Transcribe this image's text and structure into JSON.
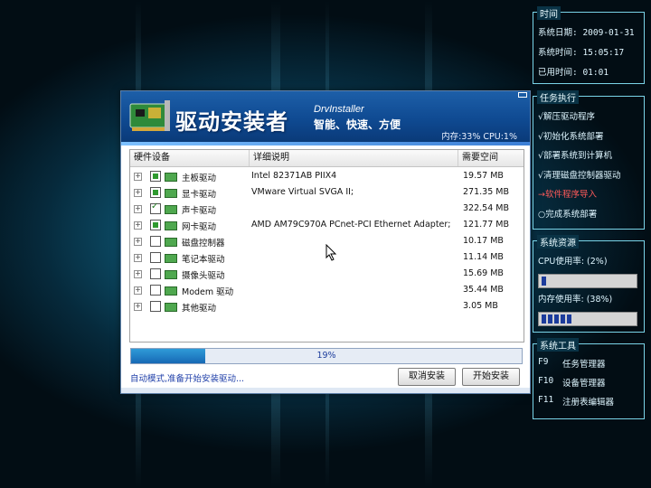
{
  "window": {
    "title": "驱动安装者",
    "brand": "DrvInstaller",
    "slogan": "智能、快速、方便",
    "stats": "内存:33%  CPU:1%"
  },
  "columns": [
    "硬件设备",
    "详细说明",
    "需要空间"
  ],
  "devices": [
    {
      "name": "主板驱动",
      "detail": "Intel 82371AB PIIX4",
      "size": "19.57 MB",
      "checked": "filled"
    },
    {
      "name": "显卡驱动",
      "detail": "VMware Virtual SVGA II;",
      "size": "271.35 MB",
      "checked": "filled"
    },
    {
      "name": "声卡驱动",
      "detail": "",
      "size": "322.54 MB",
      "checked": "tick"
    },
    {
      "name": "网卡驱动",
      "detail": "AMD AM79C970A PCnet-PCI Ethernet Adapter;",
      "size": "121.77 MB",
      "checked": "filled"
    },
    {
      "name": "磁盘控制器",
      "detail": "",
      "size": "10.17 MB",
      "checked": "none"
    },
    {
      "name": "笔记本驱动",
      "detail": "",
      "size": "11.14 MB",
      "checked": "none"
    },
    {
      "name": "摄像头驱动",
      "detail": "",
      "size": "15.69 MB",
      "checked": "none"
    },
    {
      "name": "Modem 驱动",
      "detail": "",
      "size": "35.44 MB",
      "checked": "none"
    },
    {
      "name": "其他驱动",
      "detail": "",
      "size": "3.05 MB",
      "checked": "none"
    }
  ],
  "progress": {
    "percent": 19,
    "label": "19%"
  },
  "status_text": "自动模式,准备开始安装驱动...",
  "buttons": {
    "cancel": "取消安装",
    "start": "开始安装"
  },
  "side": {
    "time": {
      "title": "时间",
      "date": "系统日期: 2009-01-31",
      "clock": "系统时间: 15:05:17",
      "elapsed": "已用时间: 01:01"
    },
    "tasks": {
      "title": "任务执行",
      "items": [
        {
          "label": "√解压驱动程序",
          "state": "done"
        },
        {
          "label": "√初始化系统部署",
          "state": "done"
        },
        {
          "label": "√部署系统到计算机",
          "state": "done"
        },
        {
          "label": "√清理磁盘控制器驱动",
          "state": "done"
        },
        {
          "label": "→软件程序导入",
          "state": "active"
        },
        {
          "label": "○完成系统部署",
          "state": "pending"
        }
      ]
    },
    "resources": {
      "title": "系统资源",
      "cpu_label": "CPU使用率:  (2%)",
      "cpu_percent": 2,
      "mem_label": "内存使用率:  (38%)",
      "mem_percent": 38
    },
    "tools": {
      "title": "系统工具",
      "items": [
        {
          "key": "F9",
          "label": "任务管理器"
        },
        {
          "key": "F10",
          "label": "设备管理器"
        },
        {
          "key": "F11",
          "label": "注册表编辑器"
        }
      ]
    }
  }
}
